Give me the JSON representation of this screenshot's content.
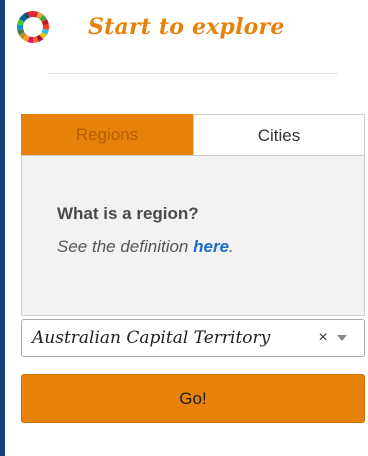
{
  "header": {
    "title": "Start to explore",
    "logo_icon": "sdg-wheel-icon"
  },
  "tabs": [
    {
      "label": "Regions",
      "active": true
    },
    {
      "label": "Cities",
      "active": false
    }
  ],
  "panel": {
    "heading": "What is a region?",
    "text_prefix": "See the definition ",
    "link_text": "here",
    "text_suffix": "."
  },
  "region_select": {
    "selected_value": "Australian Capital Territory",
    "clear_symbol": "×"
  },
  "go_button": {
    "label": "Go!"
  },
  "colors": {
    "accent": "#e8810a",
    "left_border": "#163f7a",
    "link": "#1a6fc9"
  }
}
